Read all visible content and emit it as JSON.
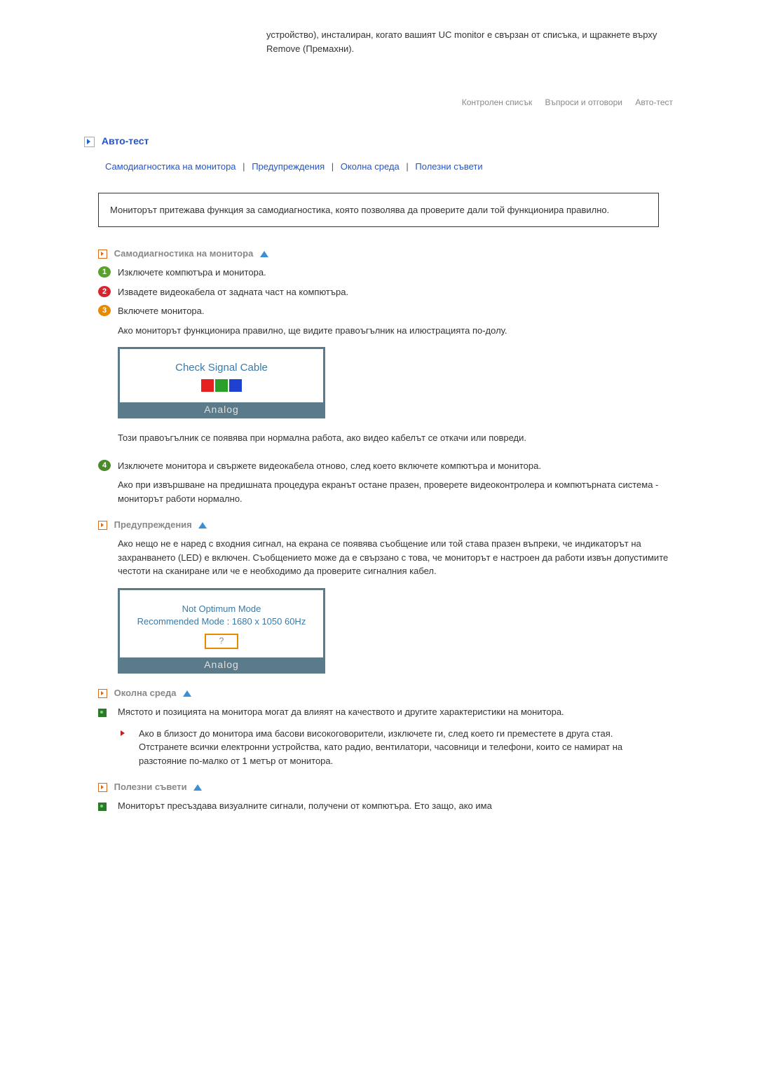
{
  "intro": "устройство), инсталиран, когато вашият UC monitor е свързан от списъка, и щракнете върху Remove (Премахни).",
  "nav": {
    "a": "Контролен списък",
    "b": "Въпроси и отговори",
    "c": "Авто-тест"
  },
  "title": "Авто-тест",
  "sublinks": {
    "self": "Самодиагностика на монитора",
    "warn": "Предупреждения",
    "env": "Околна среда",
    "tips": "Полезни съвети"
  },
  "info_box": "Мониторът притежава функция за самодиагностика, която позволява да проверите дали той функционира правилно.",
  "sec1": {
    "head": "Самодиагностика на монитора",
    "s1": "Изключете компютъра и монитора.",
    "s2": "Извадете видеокабела от задната част на компютъра.",
    "s3": "Включете монитора.",
    "s3b": "Ако мониторът функционира правилно, ще видите правоъгълник на илюстрацията по-долу.",
    "check": "Check Signal Cable",
    "analog": "Analog",
    "after": "Този правоъгълник се появява при нормална работа, ако видео кабелът се откачи или повреди.",
    "s4": "Изключете монитора и свържете видеокабела отново, след което включете компютъра и монитора.",
    "s4b": "Ако при извършване на предишната процедура екранът остане празен, проверете видеоконтролера и компютърната система - мониторът работи нормално."
  },
  "sec2": {
    "head": "Предупреждения",
    "p": "Ако нещо не е наред с входния сигнал, на екрана се появява съобщение или той става празен въпреки, че индикаторът на захранването (LED) е включен. Съобщението може да е свързано с това, че мониторът е настроен да работи извън допустимите честоти на сканиране или че е необходимо да проверите сигналния кабел.",
    "l1": "Not Optimum Mode",
    "l2": "Recommended Mode : 1680 x 1050  60Hz",
    "qm": "?",
    "analog": "Analog"
  },
  "sec3": {
    "head": "Околна среда",
    "b1": "Мястото и позицията на монитора могат да влияят на качеството и другите характеристики на монитора.",
    "sub1": "Ако в близост до монитора има басови високоговорители, изключете ги, след което ги преместете в друга стая.",
    "sub2": "Отстранете всички електронни устройства, като радио, вентилатори, часовници и телефони, които се намират на разстояние по-малко от 1 метър от монитора."
  },
  "sec4": {
    "head": "Полезни съвети",
    "b1": "Мониторът пресъздава визуалните сигнали, получени от компютъра. Ето защо, ако има"
  }
}
